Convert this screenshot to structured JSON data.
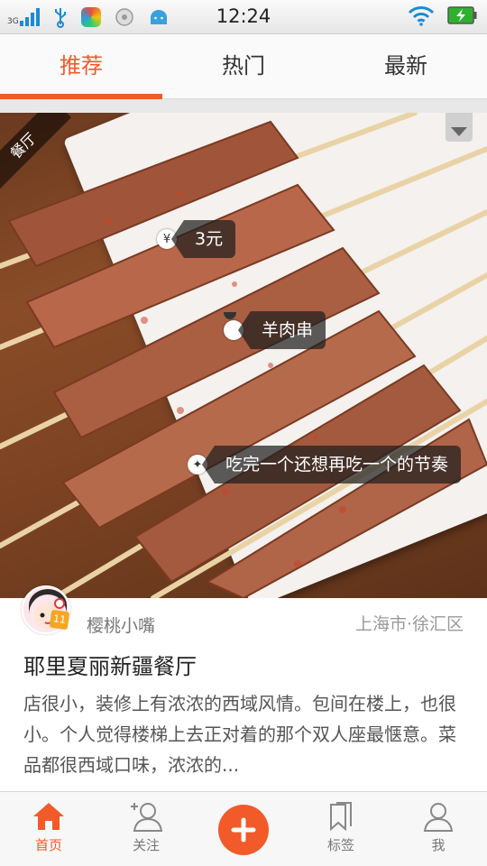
{
  "status_bar": {
    "network": "3G",
    "time": "12:24"
  },
  "tabs": [
    {
      "label": "推荐",
      "active": true
    },
    {
      "label": "热门",
      "active": false
    },
    {
      "label": "最新",
      "active": false
    }
  ],
  "post": {
    "category_ribbon": "餐厅",
    "tags": {
      "price": {
        "icon": "yen-icon",
        "text": "3元"
      },
      "dish": {
        "icon": "bowl-icon",
        "text": "羊肉串"
      },
      "comment": {
        "icon": "sparkle-icon",
        "text": "吃完一个还想再吃一个的节奏"
      }
    },
    "user": {
      "name": "樱桃小嘴",
      "level": "11"
    },
    "location": "上海市·徐汇区",
    "restaurant": "耶里夏丽新疆餐厅",
    "description": "店很小，装修上有浓浓的西域风情。包间在楼上，也很小。个人觉得楼梯上去正对着的那个双人座最惬意。菜品都很西域口味，浓浓的..."
  },
  "bottom_nav": {
    "home": "首页",
    "follow": "关注",
    "tags": "标签",
    "me": "我"
  },
  "colors": {
    "accent": "#f25a29"
  }
}
